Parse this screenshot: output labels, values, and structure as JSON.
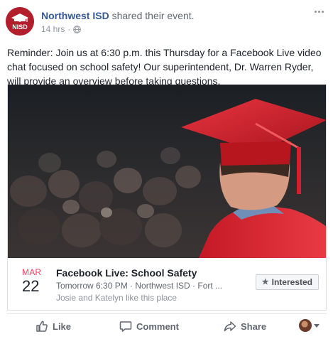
{
  "post": {
    "page_name": "Northwest ISD",
    "action_text": "shared their event.",
    "timestamp": "14 hrs",
    "separator": "·",
    "privacy_icon": "globe-icon",
    "avatar_text": "NISD",
    "message": "Reminder: Join us at 6:30 p.m. this Thursday for a Facebook Live video chat focused on school safety! Our superintendent, Dr. Warren Ryder, will provide an overview before taking questions.",
    "more_icon": "more-options-icon"
  },
  "event": {
    "month": "MAR",
    "day": "22",
    "title": "Facebook Live: School Safety",
    "when_where": "Tomorrow 6:30 PM · Northwest ISD · Fort ...",
    "social": "Josie and Katelyn like this place",
    "interested_label": "Interested",
    "interested_icon": "star-icon",
    "image_description_icon": "graduation-photo"
  },
  "actions": {
    "like_label": "Like",
    "comment_label": "Comment",
    "share_label": "Share"
  },
  "colors": {
    "link": "#365899",
    "month_red": "#f3425f",
    "brand_red": "#b21e2b",
    "muted": "#90949c"
  }
}
